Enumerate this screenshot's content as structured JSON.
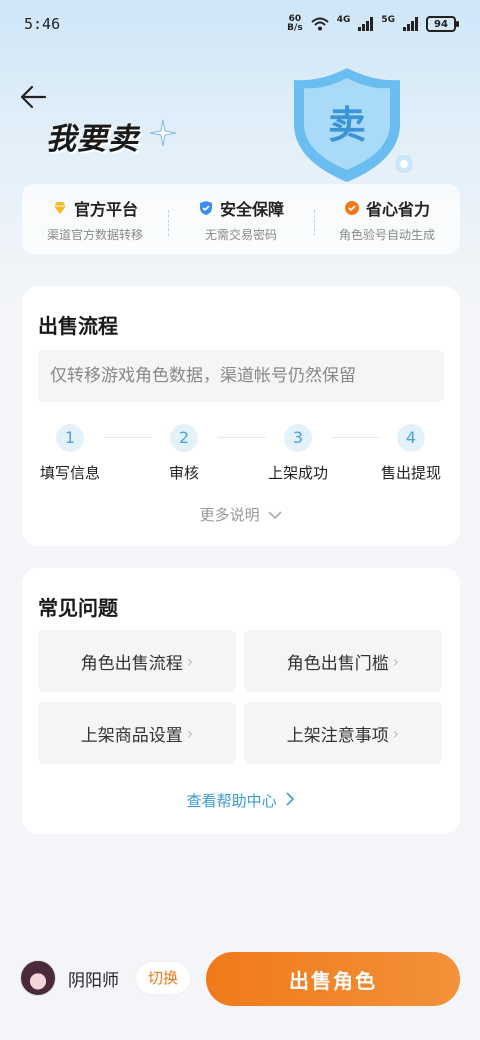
{
  "status_bar": {
    "time": "5:46",
    "net_speed_value": "60",
    "net_speed_unit": "B/s",
    "net_type_1": "4G",
    "net_type_2": "5G",
    "battery": "94"
  },
  "header": {
    "title": "我要卖",
    "shield_char": "卖"
  },
  "features": [
    {
      "title": "官方平台",
      "subtitle": "渠道官方数据转移",
      "icon": "gem-icon",
      "color": "#f5b81d"
    },
    {
      "title": "安全保障",
      "subtitle": "无需交易密码",
      "icon": "shield-check-icon",
      "color": "#3a8ef0"
    },
    {
      "title": "省心省力",
      "subtitle": "角色验号自动生成",
      "icon": "check-badge-icon",
      "color": "#f07a1a"
    }
  ],
  "process": {
    "title": "出售流程",
    "notice": "仅转移游戏角色数据，渠道帐号仍然保留",
    "steps": [
      {
        "num": "1",
        "label": "填写信息"
      },
      {
        "num": "2",
        "label": "审核"
      },
      {
        "num": "3",
        "label": "上架成功"
      },
      {
        "num": "4",
        "label": "售出提现"
      }
    ],
    "more": "更多说明"
  },
  "faq": {
    "title": "常见问题",
    "items": [
      {
        "label": "角色出售流程"
      },
      {
        "label": "角色出售门槛"
      },
      {
        "label": "上架商品设置"
      },
      {
        "label": "上架注意事项"
      }
    ],
    "help_link": "查看帮助中心"
  },
  "bottom": {
    "game_name": "阴阳师",
    "switch_label": "切换",
    "sell_label": "出售角色"
  },
  "colors": {
    "accent_orange": "#f07a1a",
    "link_blue": "#3a9bd9",
    "step_blue": "#4aa3dd"
  }
}
